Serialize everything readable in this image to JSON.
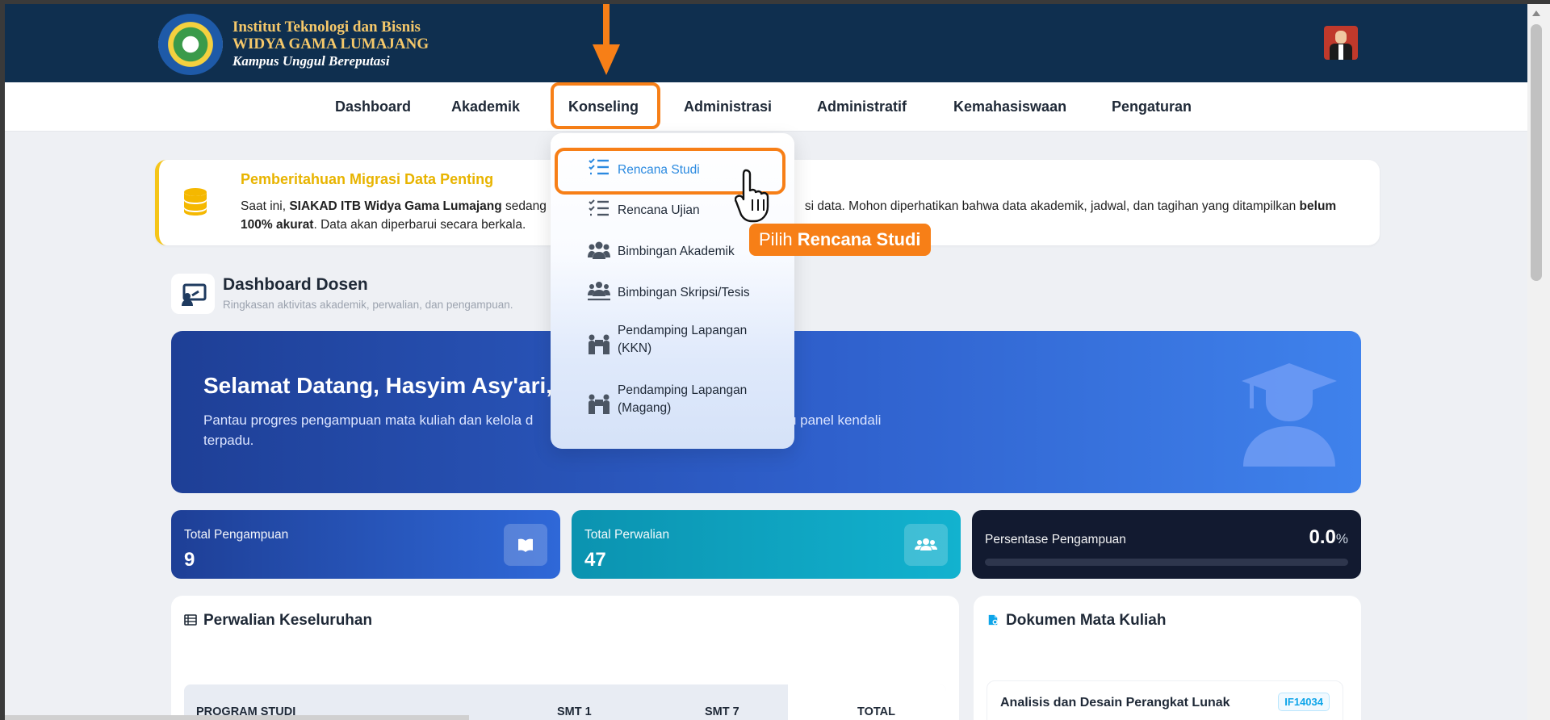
{
  "header": {
    "logo_line1": "Institut Teknologi dan Bisnis",
    "logo_line2": "WIDYA GAMA LUMAJANG",
    "logo_line3": "Kampus Unggul Bereputasi"
  },
  "nav": {
    "items": [
      {
        "label": "Dashboard"
      },
      {
        "label": "Akademik"
      },
      {
        "label": "Konseling"
      },
      {
        "label": "Administrasi"
      },
      {
        "label": "Administratif"
      },
      {
        "label": "Kemahasiswaan"
      },
      {
        "label": "Pengaturan"
      }
    ]
  },
  "dropdown": {
    "items": [
      {
        "label": "Rencana Studi",
        "icon": "list-check-icon",
        "active": true
      },
      {
        "label": "Rencana Ujian",
        "icon": "list-check-icon"
      },
      {
        "label": "Bimbingan Akademik",
        "icon": "users-icon"
      },
      {
        "label": "Bimbingan Skripsi/Tesis",
        "icon": "users-icon"
      },
      {
        "label": "Pendamping Lapangan",
        "label2": "(KKN)",
        "icon": "people-carry-icon"
      },
      {
        "label": "Pendamping Lapangan",
        "label2": "(Magang)",
        "icon": "people-carry-icon"
      }
    ]
  },
  "callout": {
    "prefix": "Pilih",
    "target": "Rencana Studi"
  },
  "notice": {
    "title": "Pemberitahuan Migrasi Data Penting",
    "p1": "Saat ini, ",
    "p_bold1": "SIAKAD ITB Widya Gama Lumajang",
    "p2": " sedang",
    "p3": "si data. Mohon diperhatikan bahwa data akademik, jadwal, dan tagihan yang ditampilkan ",
    "p_bold2": "belum 100% akurat",
    "p4": ". Data akan diperbarui secara berkala."
  },
  "dashboard": {
    "title": "Dashboard Dosen",
    "subtitle": "Ringkasan aktivitas akademik, perwalian, dan pengampuan."
  },
  "hero": {
    "greeting": "Selamat Datang, Hasyim Asy'ari,",
    "desc_left": "Pantau progres pengampuan mata kuliah dan kelola d",
    "desc_right": "satu panel kendali",
    "desc_line2": "terpadu."
  },
  "stats": {
    "pengampuan_label": "Total Pengampuan",
    "pengampuan_value": "9",
    "perwalian_label": "Total Perwalian",
    "perwalian_value": "47",
    "persentase_label": "Persentase Pengampuan",
    "persentase_value": "0.0",
    "persentase_unit": "%",
    "persentase_fraction": 0.0
  },
  "perwalian": {
    "title": "Perwalian Keseluruhan",
    "columns": [
      "PROGRAM STUDI",
      "SMT 1",
      "SMT 7",
      "TOTAL"
    ]
  },
  "dokumen": {
    "title": "Dokumen Mata Kuliah",
    "items": [
      {
        "name": "Analisis dan Desain Perangkat Lunak",
        "code": "IF14034"
      }
    ]
  },
  "colors": {
    "header_bg": "#0f2f4f",
    "accent_orange": "#f77f17",
    "active_blue": "#2b8ae0",
    "notice_yellow": "#e8b400"
  }
}
